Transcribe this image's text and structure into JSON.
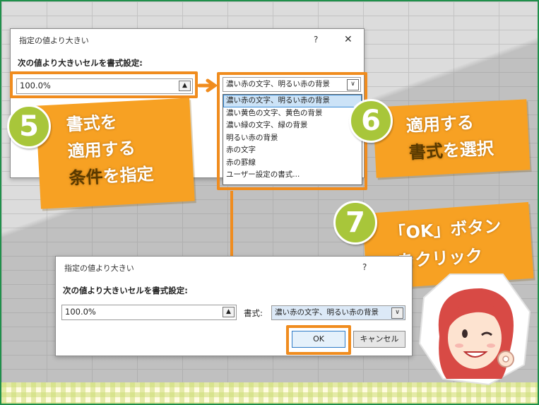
{
  "dialog_top": {
    "title": "指定の値より大きい",
    "help": "?",
    "close": "✕",
    "label": "次の値より大きいセルを書式設定:",
    "value": "100.0%",
    "select_value": "濃い赤の文字、明るい赤の背景",
    "options": [
      "濃い赤の文字、明るい赤の背景",
      "濃い黄色の文字、黄色の背景",
      "濃い緑の文字、緑の背景",
      "明るい赤の背景",
      "赤の文字",
      "赤の罫線",
      "ユーザー設定の書式..."
    ]
  },
  "dialog_bottom": {
    "title": "指定の値より大きい",
    "help": "?",
    "label": "次の値より大きいセルを書式設定:",
    "value": "100.0%",
    "format_label": "書式:",
    "select_value": "濃い赤の文字、明るい赤の背景",
    "ok_label": "OK",
    "cancel_label": "キャンセル"
  },
  "steps": {
    "step5": {
      "number": "5",
      "line1": "書式を",
      "line2": "適用する",
      "line3a": "条件",
      "line3b": "を指定"
    },
    "step6": {
      "number": "6",
      "line1": "適用する",
      "line2a": "書式",
      "line2b": "を選択"
    },
    "step7": {
      "number": "7",
      "line1": "「OK」ボタン",
      "line2": "をクリック"
    }
  },
  "colors": {
    "accent": "#f7a123",
    "badge": "#a8c63a",
    "frame": "#1f8f4a"
  },
  "icons": {
    "spin": "spin-up-icon",
    "dropdown": "chevron-down-icon"
  }
}
